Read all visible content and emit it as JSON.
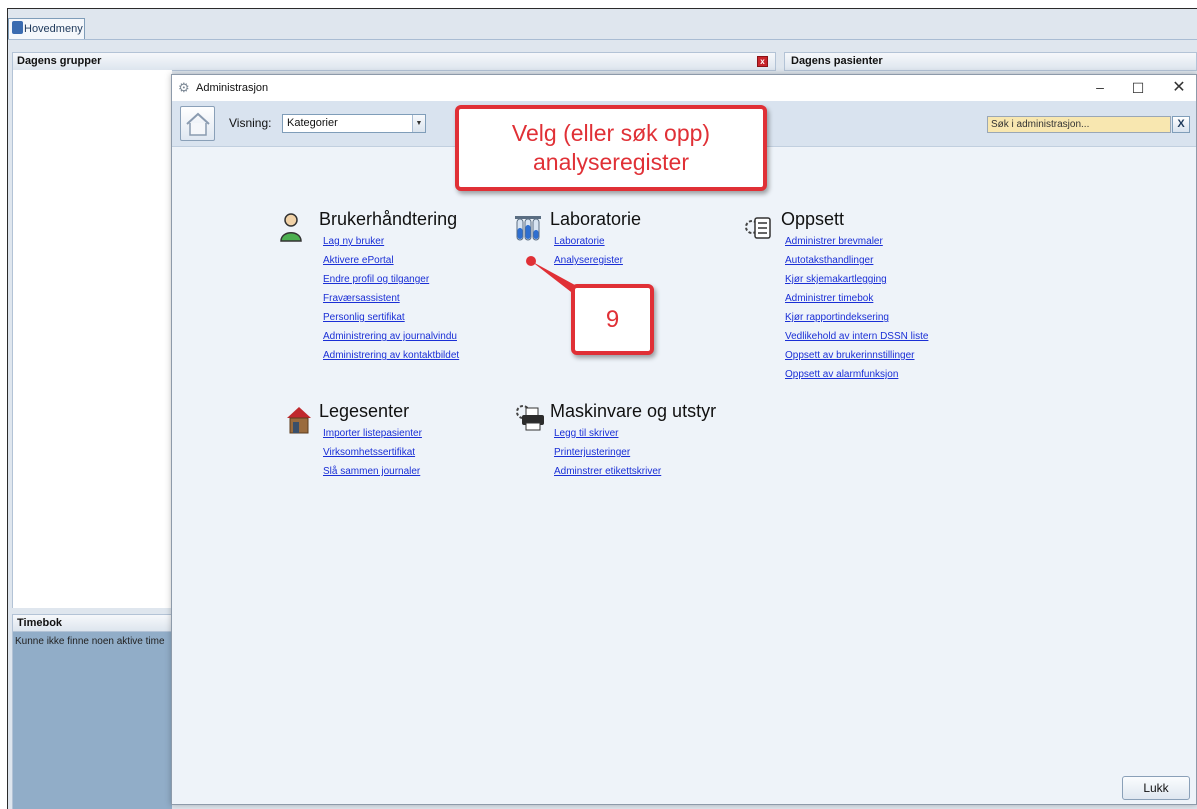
{
  "main_window": {
    "tab_label": "Hovedmeny",
    "groups_header": "Dagens grupper",
    "patients_header": "Dagens pasienter",
    "timebok_header": "Timebok",
    "timebok_message": "Kunne ikke finne noen aktive time"
  },
  "dialog": {
    "title": "Administrasjon",
    "window_controls": {
      "minimize": "–",
      "maximize": "☐",
      "close": "✕"
    },
    "toolbar": {
      "view_label": "Visning:",
      "view_value": "Kategorier",
      "search_placeholder": "Søk i administrasjon...",
      "search_clear": "X"
    },
    "categories": [
      {
        "title": "Brukerhåndtering",
        "icon": "user-icon",
        "links": [
          "Lag ny bruker",
          "Aktivere ePortal",
          "Endre profil og tilganger",
          "Fraværsassistent",
          "Personlig sertifikat",
          "Administrering av journalvindu",
          "Administrering av kontaktbildet"
        ]
      },
      {
        "title": "Laboratorie",
        "icon": "test-tubes-icon",
        "links": [
          "Laboratorie",
          "Analyseregister"
        ]
      },
      {
        "title": "Oppsett",
        "icon": "settings-list-icon",
        "links": [
          "Administrer brevmaler",
          "Autotaksthandlinger",
          "Kjør skjemakartlegging",
          "Administrer timebok",
          "Kjør rapportindeksering",
          "Vedlikehold av intern DSSN liste",
          "Oppsett av brukerinnstillinger",
          "Oppsett av alarmfunksjon"
        ]
      },
      {
        "title": "Legesenter",
        "icon": "house-icon",
        "links": [
          "Importer listepasienter",
          "Virksomhetssertifikat",
          "Slå sammen journaler"
        ]
      },
      {
        "title": "Maskinvare og utstyr",
        "icon": "printer-icon",
        "links": [
          "Legg til skriver",
          "Printerjusteringer",
          "Adminstrer etikettskriver"
        ]
      }
    ],
    "close_button": "Lukk"
  },
  "annotations": {
    "instruction_line1": "Velg (eller søk opp)",
    "instruction_line2": "analyseregister",
    "step_number": "9",
    "accent_color": "#e03036"
  }
}
